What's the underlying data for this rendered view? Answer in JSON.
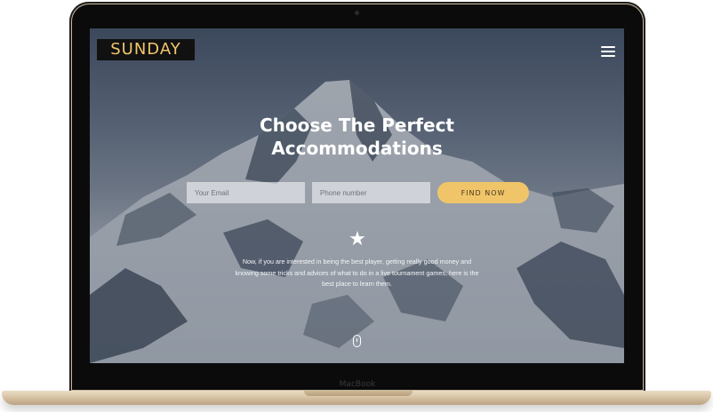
{
  "device": {
    "brand_label": "MacBook"
  },
  "nav": {
    "logo_text": "SUNDAY",
    "menu_icon": "hamburger-menu-icon"
  },
  "hero": {
    "headline_line1": "Choose The Perfect",
    "headline_line2": "Accommodations",
    "email_placeholder": "Your Email",
    "phone_placeholder": "Phone number",
    "cta_label": "FIND NOW",
    "divider_icon": "star-icon",
    "divider_glyph": "★",
    "description": "Now, if you are interested in being the best player, getting really good money and knowing some tricks and advices of what to do in a live tournament games, here is the best place to learn them.",
    "scroll_icon": "mouse-scroll-icon"
  },
  "colors": {
    "accent": "#f0c56a",
    "logo_background": "#111111",
    "logo_text": "#f2c66b"
  }
}
